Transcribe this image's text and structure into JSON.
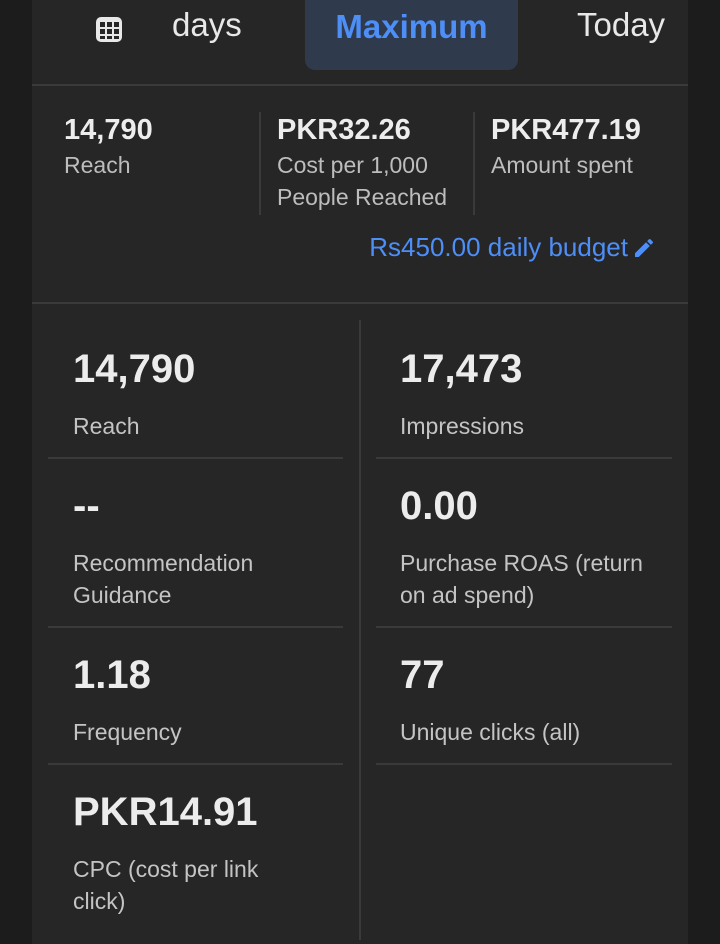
{
  "tabs": {
    "days_label": "days",
    "maximum_label": "Maximum",
    "today_label": "Today",
    "active": "Maximum",
    "calendar_icon": "calendar-grid-icon"
  },
  "summary": {
    "reach": {
      "value": "14,790",
      "label": "Reach"
    },
    "cpm": {
      "value": "PKR32.26",
      "label_line1": "Cost per 1,000",
      "label_line2": "People Reached"
    },
    "spent": {
      "value": "PKR477.19",
      "label": "Amount spent"
    },
    "budget_label": "Rs450.00 daily budget",
    "budget_icon": "pencil-icon"
  },
  "metrics": [
    {
      "value": "14,790",
      "label_line1": "Reach",
      "label_line2": ""
    },
    {
      "value": "17,473",
      "label_line1": "Impressions",
      "label_line2": ""
    },
    {
      "value": "--",
      "label_line1": "Recommendation",
      "label_line2": "Guidance"
    },
    {
      "value": "0.00",
      "label_line1": "Purchase ROAS (return",
      "label_line2": "on ad spend)"
    },
    {
      "value": "1.18",
      "label_line1": "Frequency",
      "label_line2": ""
    },
    {
      "value": "77",
      "label_line1": "Unique clicks (all)",
      "label_line2": ""
    },
    {
      "value": "PKR14.91",
      "label_line1": "CPC (cost per link",
      "label_line2": "click)"
    }
  ],
  "colors": {
    "background": "#1c1c1c",
    "panel": "#262626",
    "accent": "#4d8ef7",
    "active_tab": "#2f3a4d"
  }
}
